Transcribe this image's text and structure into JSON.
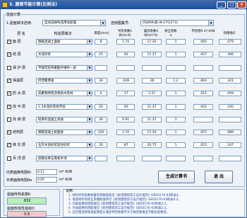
{
  "window": {
    "title": "3. 屋面节能计算(比例法)"
  },
  "section": {
    "title": "屋面计算"
  },
  "top": {
    "label1": "1.屋面做法选用:",
    "combo1": "自动选择构造用途屋面",
    "label2": "选用图集号:",
    "combo2": "05J909(屋-W-275/273)"
  },
  "headers": {
    "layer": "层 名",
    "material": "构造层做法",
    "thickness": "厚度(mm)",
    "conductivity": "导热系数λ W/(m·K)",
    "storage": "蓄热系数S W/(m²·K)",
    "correction": "修正系数 α",
    "resistance": "传热阻R m²·K/W",
    "inertia": "热惰性D"
  },
  "rows": [
    {
      "checked": true,
      "layer": "面 层",
      "material": "钢筋混凝土面板",
      "thick": "8",
      "lambda": "1.74",
      "s": "17.20",
      "a": "1",
      "r": ".005",
      "d": ".079"
    },
    {
      "checked": true,
      "layer": "结 层",
      "material": "水泥砂浆",
      "thick": "25",
      "lambda": ".93",
      "s": "11.37",
      "a": "1",
      "r": ".027",
      "d": ".306"
    },
    {
      "checked": false,
      "layer": "保 护 层",
      "material": "平铺无纺布聚酯纤维布一层",
      "thick": "",
      "lambda": "",
      "s": "",
      "a": "",
      "r": "",
      "d": ""
    },
    {
      "checked": true,
      "layer": "保温层",
      "material": "挤塑聚苯板",
      "thick": "30",
      "lambda": ".028",
      "s": ".36",
      "a": "1.2",
      "r": ".893",
      "d": ".321"
    },
    {
      "checked": true,
      "layer": "防 水 层",
      "material": "高聚物改性沥青防水卷材",
      "thick": "4",
      "lambda": ".17",
      "s": "3.37",
      "a": "1",
      "r": ".015",
      "d": ".059"
    },
    {
      "checked": true,
      "layer": "找 平 层",
      "material": "1:3水泥砂浆找平层",
      "thick": "20",
      "lambda": ".93",
      "s": "11.37",
      "a": "1",
      "r": ".022",
      "d": ".245"
    },
    {
      "checked": false,
      "layer": "找 坡 层",
      "material": "轻骨料混凝土找坡",
      "thick": "30",
      "lambda": "0.91",
      "s": "11.37",
      "a": "1",
      "r": "",
      "d": ""
    },
    {
      "checked": true,
      "layer": "结构层",
      "material": "钢筋混凝土屋面板",
      "thick": "120",
      "lambda": "1.74",
      "s": "17.20",
      "a": "1",
      "r": ".057",
      "d": ".989"
    },
    {
      "checked": true,
      "layer": "抹 灰 层",
      "material": "石灰水泥砂浆混合砂浆",
      "thick": "20",
      "lambda": ".87",
      "s": "10.75",
      "a": "1",
      "r": ".023",
      "d": ".247"
    },
    {
      "checked": false,
      "layer": "吊 顶 层",
      "material": "轻钢龙骨石膏板吊顶",
      "thick": "",
      "lambda": "",
      "s": "",
      "a": "",
      "r": "",
      "d": ""
    }
  ],
  "resist": {
    "inner_label": "内表面换热阻Ri",
    "inner_val": "0.11",
    "outer_label": "外表面换热阻Re",
    "outer_val": "0.05",
    "unit": "m²·K/W"
  },
  "buttons": {
    "generate": "生成计算书",
    "exit": "退 出"
  },
  "results": {
    "k_label": "屋面传热系数K",
    "k_value": ".832",
    "d_label": "屋面热惰性指标D",
    "d_value": "0.9"
  },
  "notes": {
    "title": "说明:",
    "lines": [
      "1. 材料导热系数和蓄热系数取值见《民用建筑热工设计规范》GB50176-93附录4。",
      "2. 保温材料的修正系数取值参见《民用建筑热工设计规范》GB50176-93附录4.2。",
      "3. 内表面换热阻取值见《民用建筑热工设计规范》GB50176-93附表2.2。",
      "4. 外表面换热阻取值见《民用建筑热工设计规范》GB50176-93附表2.3。",
      "5. 应合理选择保温层厚度以满足传热系数不大于规范限值且节能标准要求。"
    ]
  },
  "colors": {
    "title": "#1e4f9c",
    "output_green": "#b8f0b8",
    "output_pink": "#f7c6c6"
  }
}
